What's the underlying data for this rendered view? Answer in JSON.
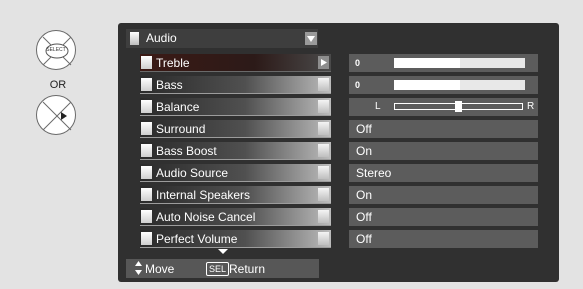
{
  "remote": {
    "select_label": "SELECT",
    "or_label": "OR"
  },
  "menu": {
    "title": "Audio",
    "items": [
      {
        "label": "Treble",
        "selected": true
      },
      {
        "label": "Bass"
      },
      {
        "label": "Balance"
      },
      {
        "label": "Surround"
      },
      {
        "label": "Bass Boost"
      },
      {
        "label": "Audio Source"
      },
      {
        "label": "Internal Speakers"
      },
      {
        "label": "Auto Noise Cancel"
      },
      {
        "label": "Perfect Volume"
      }
    ]
  },
  "values": {
    "treble": {
      "number": "0",
      "level": 0.5
    },
    "bass": {
      "number": "0",
      "level": 0.5
    },
    "balance": {
      "left": "L",
      "right": "R",
      "level": 0.5
    },
    "surround": "Off",
    "bass_boost": "On",
    "audio_source": "Stereo",
    "internal_speakers": "On",
    "auto_noise_cancel": "Off",
    "perfect_volume": "Off"
  },
  "footer": {
    "move": "Move",
    "sel": "SEL",
    "return": "Return"
  }
}
